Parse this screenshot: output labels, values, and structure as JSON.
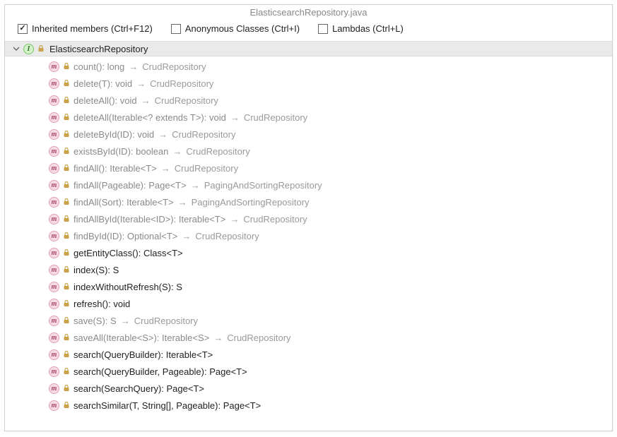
{
  "title": "ElasticsearchRepository.java",
  "options": {
    "inherited": {
      "label": "Inherited members (Ctrl+F12)",
      "checked": true
    },
    "anonymous": {
      "label": "Anonymous Classes (Ctrl+I)",
      "checked": false
    },
    "lambdas": {
      "label": "Lambdas (Ctrl+L)",
      "checked": false
    }
  },
  "class": {
    "name": "ElasticsearchRepository"
  },
  "methods": [
    {
      "sig": "count(): long",
      "origin": "CrudRepository",
      "inherited": true
    },
    {
      "sig": "delete(T): void",
      "origin": "CrudRepository",
      "inherited": true
    },
    {
      "sig": "deleteAll(): void",
      "origin": "CrudRepository",
      "inherited": true
    },
    {
      "sig": "deleteAll(Iterable<? extends T>): void",
      "origin": "CrudRepository",
      "inherited": true
    },
    {
      "sig": "deleteById(ID): void",
      "origin": "CrudRepository",
      "inherited": true
    },
    {
      "sig": "existsById(ID): boolean",
      "origin": "CrudRepository",
      "inherited": true
    },
    {
      "sig": "findAll(): Iterable<T>",
      "origin": "CrudRepository",
      "inherited": true
    },
    {
      "sig": "findAll(Pageable): Page<T>",
      "origin": "PagingAndSortingRepository",
      "inherited": true
    },
    {
      "sig": "findAll(Sort): Iterable<T>",
      "origin": "PagingAndSortingRepository",
      "inherited": true
    },
    {
      "sig": "findAllById(Iterable<ID>): Iterable<T>",
      "origin": "CrudRepository",
      "inherited": true
    },
    {
      "sig": "findById(ID): Optional<T>",
      "origin": "CrudRepository",
      "inherited": true
    },
    {
      "sig": "getEntityClass(): Class<T>",
      "origin": "",
      "inherited": false
    },
    {
      "sig": "index(S): S",
      "origin": "",
      "inherited": false
    },
    {
      "sig": "indexWithoutRefresh(S): S",
      "origin": "",
      "inherited": false
    },
    {
      "sig": "refresh(): void",
      "origin": "",
      "inherited": false
    },
    {
      "sig": "save(S): S",
      "origin": "CrudRepository",
      "inherited": true
    },
    {
      "sig": "saveAll(Iterable<S>): Iterable<S>",
      "origin": "CrudRepository",
      "inherited": true
    },
    {
      "sig": "search(QueryBuilder): Iterable<T>",
      "origin": "",
      "inherited": false
    },
    {
      "sig": "search(QueryBuilder, Pageable): Page<T>",
      "origin": "",
      "inherited": false
    },
    {
      "sig": "search(SearchQuery): Page<T>",
      "origin": "",
      "inherited": false
    },
    {
      "sig": "searchSimilar(T, String[], Pageable): Page<T>",
      "origin": "",
      "inherited": false
    }
  ]
}
